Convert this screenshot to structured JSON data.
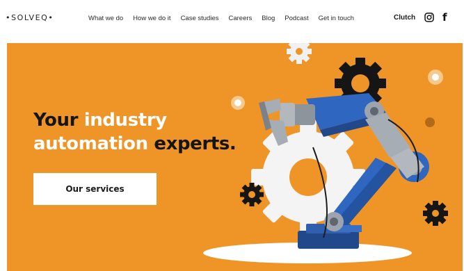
{
  "header": {
    "logo": "•SOLVEQ•",
    "nav": [
      "What we do",
      "How we do it",
      "Case studies",
      "Careers",
      "Blog",
      "Podcast",
      "Get in touch"
    ],
    "clutch": "Clutch",
    "instagram_icon": "instagram-icon",
    "facebook_icon": "facebook-icon"
  },
  "hero": {
    "headline_part1": "Your ",
    "headline_highlight1": "industry",
    "headline_highlight2": "automation",
    "headline_part2": " experts.",
    "cta_label": "Our services",
    "background": "#ef9527",
    "highlight_color": "#ffffff"
  }
}
